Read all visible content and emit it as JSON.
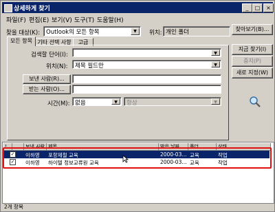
{
  "window": {
    "title": "상세하게 찾기"
  },
  "titlebar_buttons": {
    "minimize": "_",
    "maximize": "□",
    "close": "×"
  },
  "menu": [
    "파일(F)",
    "편집(E)",
    "보기(V)",
    "도구(T)",
    "도움말(H)"
  ],
  "search_target": {
    "label": "찾을 대상(K):",
    "value": "Outlook의 모든 항목"
  },
  "location": {
    "label": "위치:",
    "value": "개인 폴더"
  },
  "browse_button": "찾아보기(B)...",
  "tabs": [
    "모든 항목",
    "기타 선택 사항",
    "고급"
  ],
  "search_words": {
    "label": "검색할 단어(I):",
    "value": ""
  },
  "in_field": {
    "label": "위치(N):",
    "value": "제목 필드만"
  },
  "from_button": "보낸 사람(R)...",
  "sent_to_button": "받는 사람(O)...",
  "time": {
    "label": "시간(M):",
    "value": "없음",
    "value2": "항상"
  },
  "side_buttons": {
    "find_now": "지금 찾기(I)",
    "stop": "중지(P)",
    "new_search": "새로 지정(W)"
  },
  "search_icon": "magnifier-icon",
  "columns": [
    "!",
    "",
    "보낸 사람",
    "제목",
    "받은 날짜",
    "폴더",
    "상태"
  ],
  "rows": [
    {
      "checked": "✓",
      "from": "이하영",
      "subject": "포항제철 교육",
      "date": "2000-03...",
      "folder": "교육",
      "status": "작업",
      "selected": true
    },
    {
      "checked": "✓",
      "from": "이하영",
      "subject": "하이텔 정보교류원 교육",
      "date": "2000-03...",
      "folder": "교육",
      "status": "작업",
      "selected": false
    }
  ],
  "status": "2개 항목",
  "colors": {
    "titlebar": "#0a246a",
    "highlight": "#e01010",
    "face": "#d4d0c8"
  }
}
